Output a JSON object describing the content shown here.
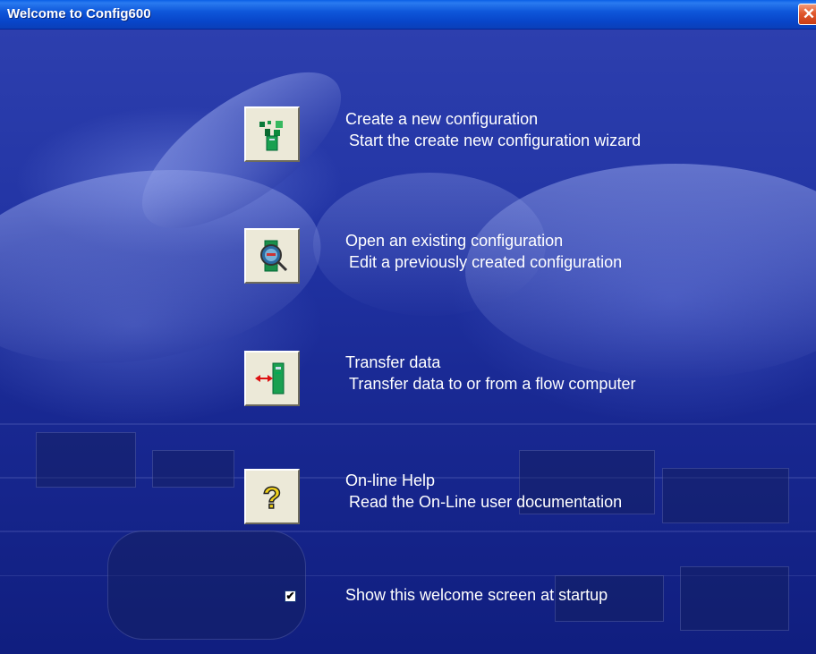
{
  "window": {
    "title": "Welcome to Config600",
    "close_glyph": "✕"
  },
  "items": [
    {
      "title": "Create a new configuration",
      "description": "Start the create new configuration wizard",
      "icon": "new-configuration-icon"
    },
    {
      "title": "Open an existing configuration",
      "description": "Edit a previously created configuration",
      "icon": "open-configuration-icon"
    },
    {
      "title": "Transfer data",
      "description": "Transfer data to or from a flow computer",
      "icon": "transfer-data-icon"
    },
    {
      "title": "On-line Help",
      "description": "Read the On-Line user documentation",
      "icon": "help-icon"
    }
  ],
  "startup": {
    "label": "Show this welcome screen at startup",
    "checked": true,
    "check_glyph": "✔"
  },
  "colors": {
    "titlebar": "#0845c9",
    "background": "#1a2a95",
    "button_face": "#ece9d8",
    "close": "#e0582d"
  }
}
